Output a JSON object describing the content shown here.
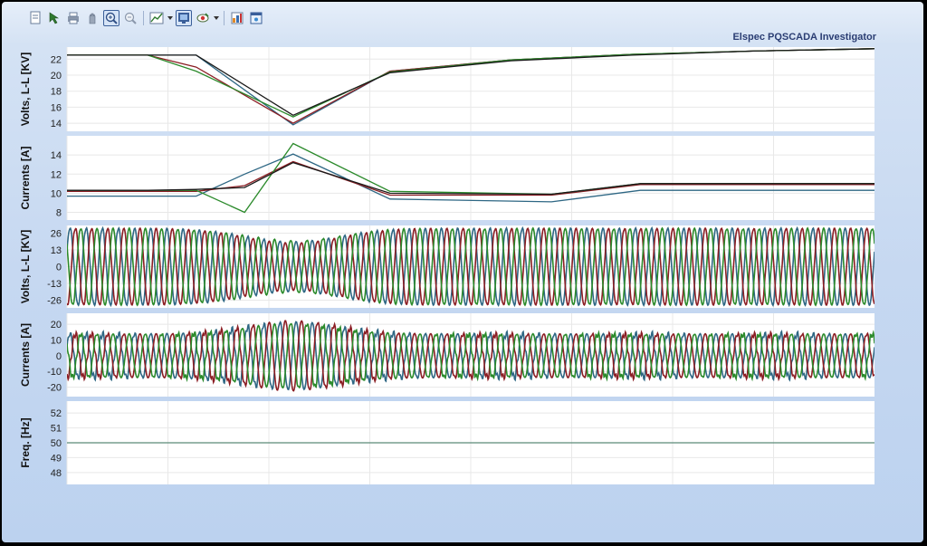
{
  "app": {
    "title": "Elspec PQSCADA Investigator"
  },
  "toolbar": {
    "buttons": [
      {
        "icon": "document-icon",
        "active": false
      },
      {
        "icon": "cursor-select-icon",
        "active": false
      },
      {
        "icon": "print-icon",
        "active": false
      },
      {
        "icon": "pan-hand-icon",
        "active": false
      },
      {
        "icon": "zoom-in-icon",
        "active": true
      },
      {
        "icon": "zoom-out-icon",
        "active": false
      },
      {
        "icon": "chart-view-icon",
        "active": false,
        "dropdown": true
      },
      {
        "icon": "display-mode-icon",
        "active": true
      },
      {
        "icon": "color-eye-icon",
        "active": false,
        "dropdown": true
      },
      {
        "icon": "layout-icon",
        "active": false
      },
      {
        "icon": "window-icon",
        "active": false
      }
    ]
  },
  "colors": {
    "phase_a": "#2e6784",
    "phase_b": "#8b1e24",
    "phase_c": "#2b8a2b",
    "neutral": "#1a1a1a",
    "grid": "#e8e8e8",
    "frequency": "#5b8a78"
  },
  "chart_data": [
    {
      "type": "line",
      "ylabel": "Volts, L-L [KV]",
      "yticks": [
        22,
        20,
        18,
        16,
        14
      ],
      "ylim": [
        13,
        23.5
      ],
      "grid": true,
      "x": [
        0,
        0.1,
        0.16,
        0.28,
        0.4,
        0.55,
        0.7,
        0.85,
        1.0
      ],
      "series": [
        {
          "values": [
            22.5,
            22.5,
            22.5,
            13.8,
            20.5,
            21.9,
            22.6,
            23.0,
            23.3
          ]
        },
        {
          "values": [
            22.5,
            22.5,
            21.0,
            14.0,
            20.5,
            21.9,
            22.6,
            23.0,
            23.3
          ]
        },
        {
          "values": [
            22.5,
            22.5,
            20.5,
            14.8,
            20.4,
            21.9,
            22.6,
            23.0,
            23.3
          ]
        },
        {
          "values": [
            22.5,
            22.5,
            22.5,
            15.0,
            20.3,
            21.8,
            22.5,
            23.0,
            23.3
          ]
        }
      ]
    },
    {
      "type": "line",
      "ylabel": "Currents [A]",
      "yticks": [
        14,
        12,
        10,
        8
      ],
      "ylim": [
        7.2,
        16
      ],
      "grid": true,
      "x": [
        0,
        0.1,
        0.16,
        0.22,
        0.28,
        0.4,
        0.6,
        0.71,
        1.0
      ],
      "series": [
        {
          "values": [
            9.7,
            9.7,
            9.7,
            12.0,
            14.1,
            9.4,
            9.1,
            10.3,
            10.3
          ]
        },
        {
          "values": [
            10.2,
            10.2,
            10.2,
            10.8,
            13.3,
            9.8,
            9.8,
            10.9,
            10.9
          ]
        },
        {
          "values": [
            10.3,
            10.3,
            10.3,
            8.0,
            15.2,
            10.2,
            9.9,
            11.0,
            11.0
          ]
        },
        {
          "values": [
            10.3,
            10.3,
            10.4,
            10.6,
            13.2,
            10.0,
            9.9,
            11.0,
            11.0
          ]
        }
      ]
    },
    {
      "type": "line",
      "ylabel": "Volts, L-L [KV]",
      "yticks": [
        26,
        13,
        0,
        -13,
        -26
      ],
      "ylim": [
        -32,
        32
      ],
      "grid": true,
      "waveform": {
        "cycles": 50,
        "amplitude": 30,
        "sag_center": 0.28,
        "sag_depth": 0.35,
        "distortion": 1.2
      }
    },
    {
      "type": "line",
      "ylabel": "Currents [A]",
      "yticks": [
        20,
        10,
        0,
        -10,
        -20
      ],
      "ylim": [
        -26,
        27
      ],
      "grid": true,
      "waveform": {
        "cycles": 50,
        "amplitude": 14,
        "sag_center": 0.28,
        "sag_depth": -0.55,
        "distortion": 2.5
      }
    },
    {
      "type": "line",
      "ylabel": "Freq. [Hz]",
      "yticks": [
        52,
        51,
        50,
        49,
        48
      ],
      "ylim": [
        47.2,
        52.8
      ],
      "grid": true,
      "series": [
        {
          "values": [
            50,
            50
          ]
        }
      ]
    }
  ]
}
